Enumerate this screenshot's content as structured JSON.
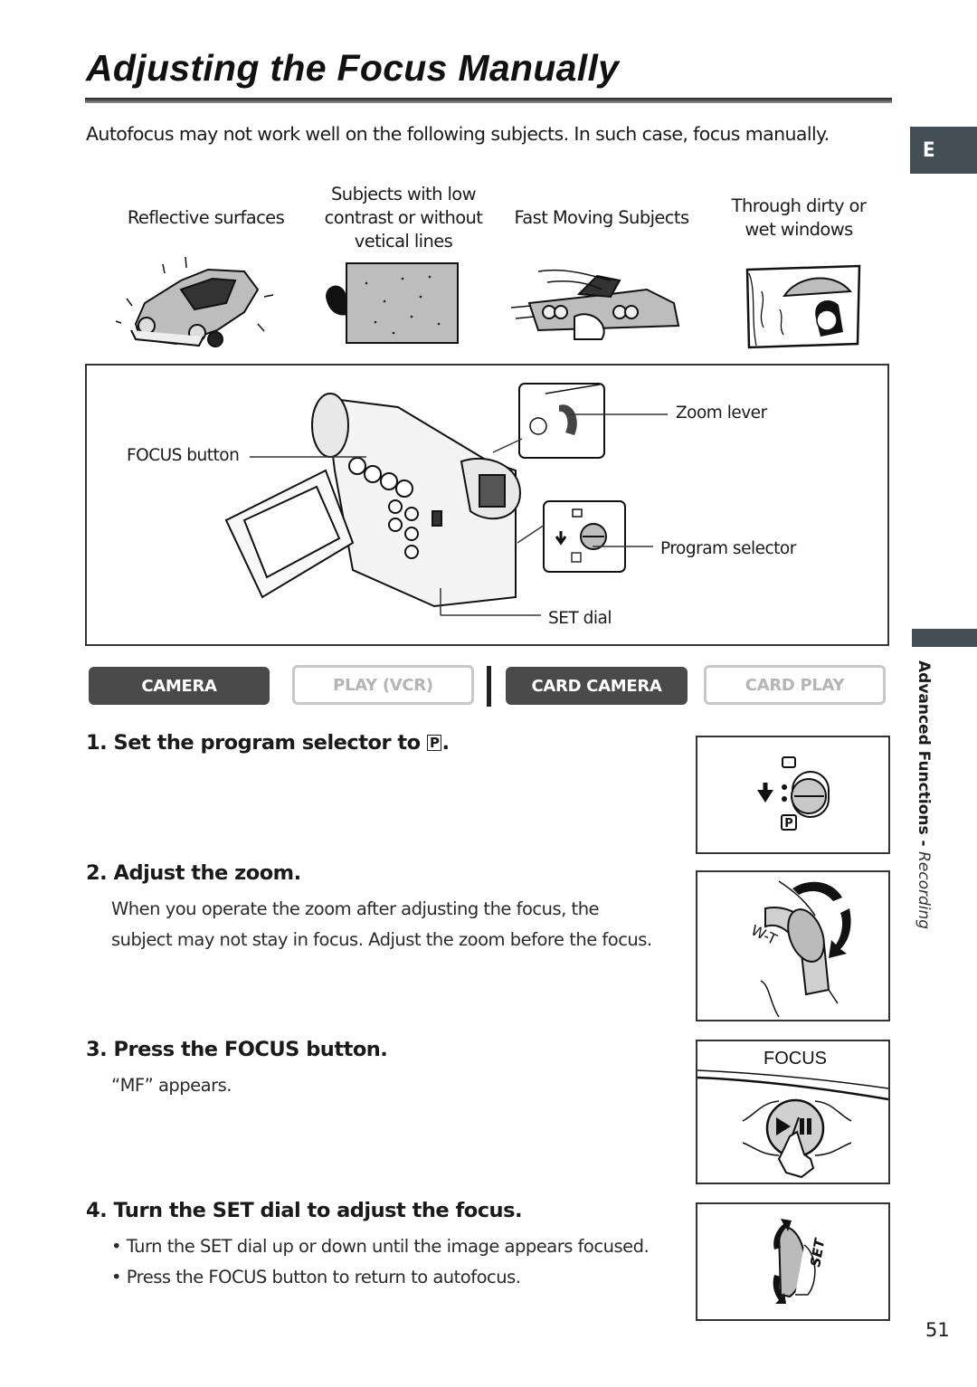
{
  "page": {
    "title": "Adjusting the Focus Manually",
    "intro": "Autofocus may not work well on the following subjects. In such case, focus manually.",
    "language_tab": "E",
    "page_number": "51"
  },
  "subjects": [
    {
      "caption_lines": [
        "Reflective surfaces"
      ],
      "illustration": "shiny-car-illustration"
    },
    {
      "caption_lines": [
        "Subjects with low",
        "contrast or without",
        "vetical lines"
      ],
      "illustration": "blank-wall-illustration"
    },
    {
      "caption_lines": [
        "Fast Moving Subjects"
      ],
      "illustration": "fast-car-illustration"
    },
    {
      "caption_lines": [
        "Through dirty or",
        "wet windows"
      ],
      "illustration": "wet-window-illustration"
    }
  ],
  "diagram": {
    "callouts": {
      "focus_button": "FOCUS button",
      "zoom_lever": "Zoom lever",
      "program_selector": "Program selector",
      "set_dial": "SET dial"
    },
    "zoom_lever_marking": "W-T",
    "selector_mode": "P"
  },
  "modes": [
    {
      "label": "CAMERA",
      "active": true
    },
    {
      "label": "PLAY (VCR)",
      "active": false
    },
    {
      "label": "CARD CAMERA",
      "active": true
    },
    {
      "label": "CARD PLAY",
      "active": false
    }
  ],
  "sidebar": {
    "section": "Advanced Functions -",
    "subsection": "Recording"
  },
  "steps": [
    {
      "number": "1.",
      "title": "Set the program selector to",
      "title_symbol": "P",
      "title_end": ".",
      "body": []
    },
    {
      "number": "2.",
      "title": "Adjust the zoom.",
      "body": [
        "When you operate the zoom after adjusting the focus, the",
        "subject may not stay in focus. Adjust the zoom before the focus."
      ]
    },
    {
      "number": "3.",
      "title": "Press the FOCUS button.",
      "body": [
        "“MF” appears."
      ]
    },
    {
      "number": "4.",
      "title": "Turn the SET dial to adjust the focus.",
      "bullets": [
        "Turn the SET dial up or down until the image appears focused.",
        "Press the FOCUS button to return to autofocus."
      ]
    }
  ],
  "step_figures": {
    "selector_symbol": "P",
    "zoom_marking": "W-T",
    "focus_label": "FOCUS",
    "set_label": "SET"
  },
  "colors": {
    "tab_fill": "#434f55",
    "mode_active": "#4a4a4a",
    "mode_inactive_text": "#b5b5b5"
  }
}
